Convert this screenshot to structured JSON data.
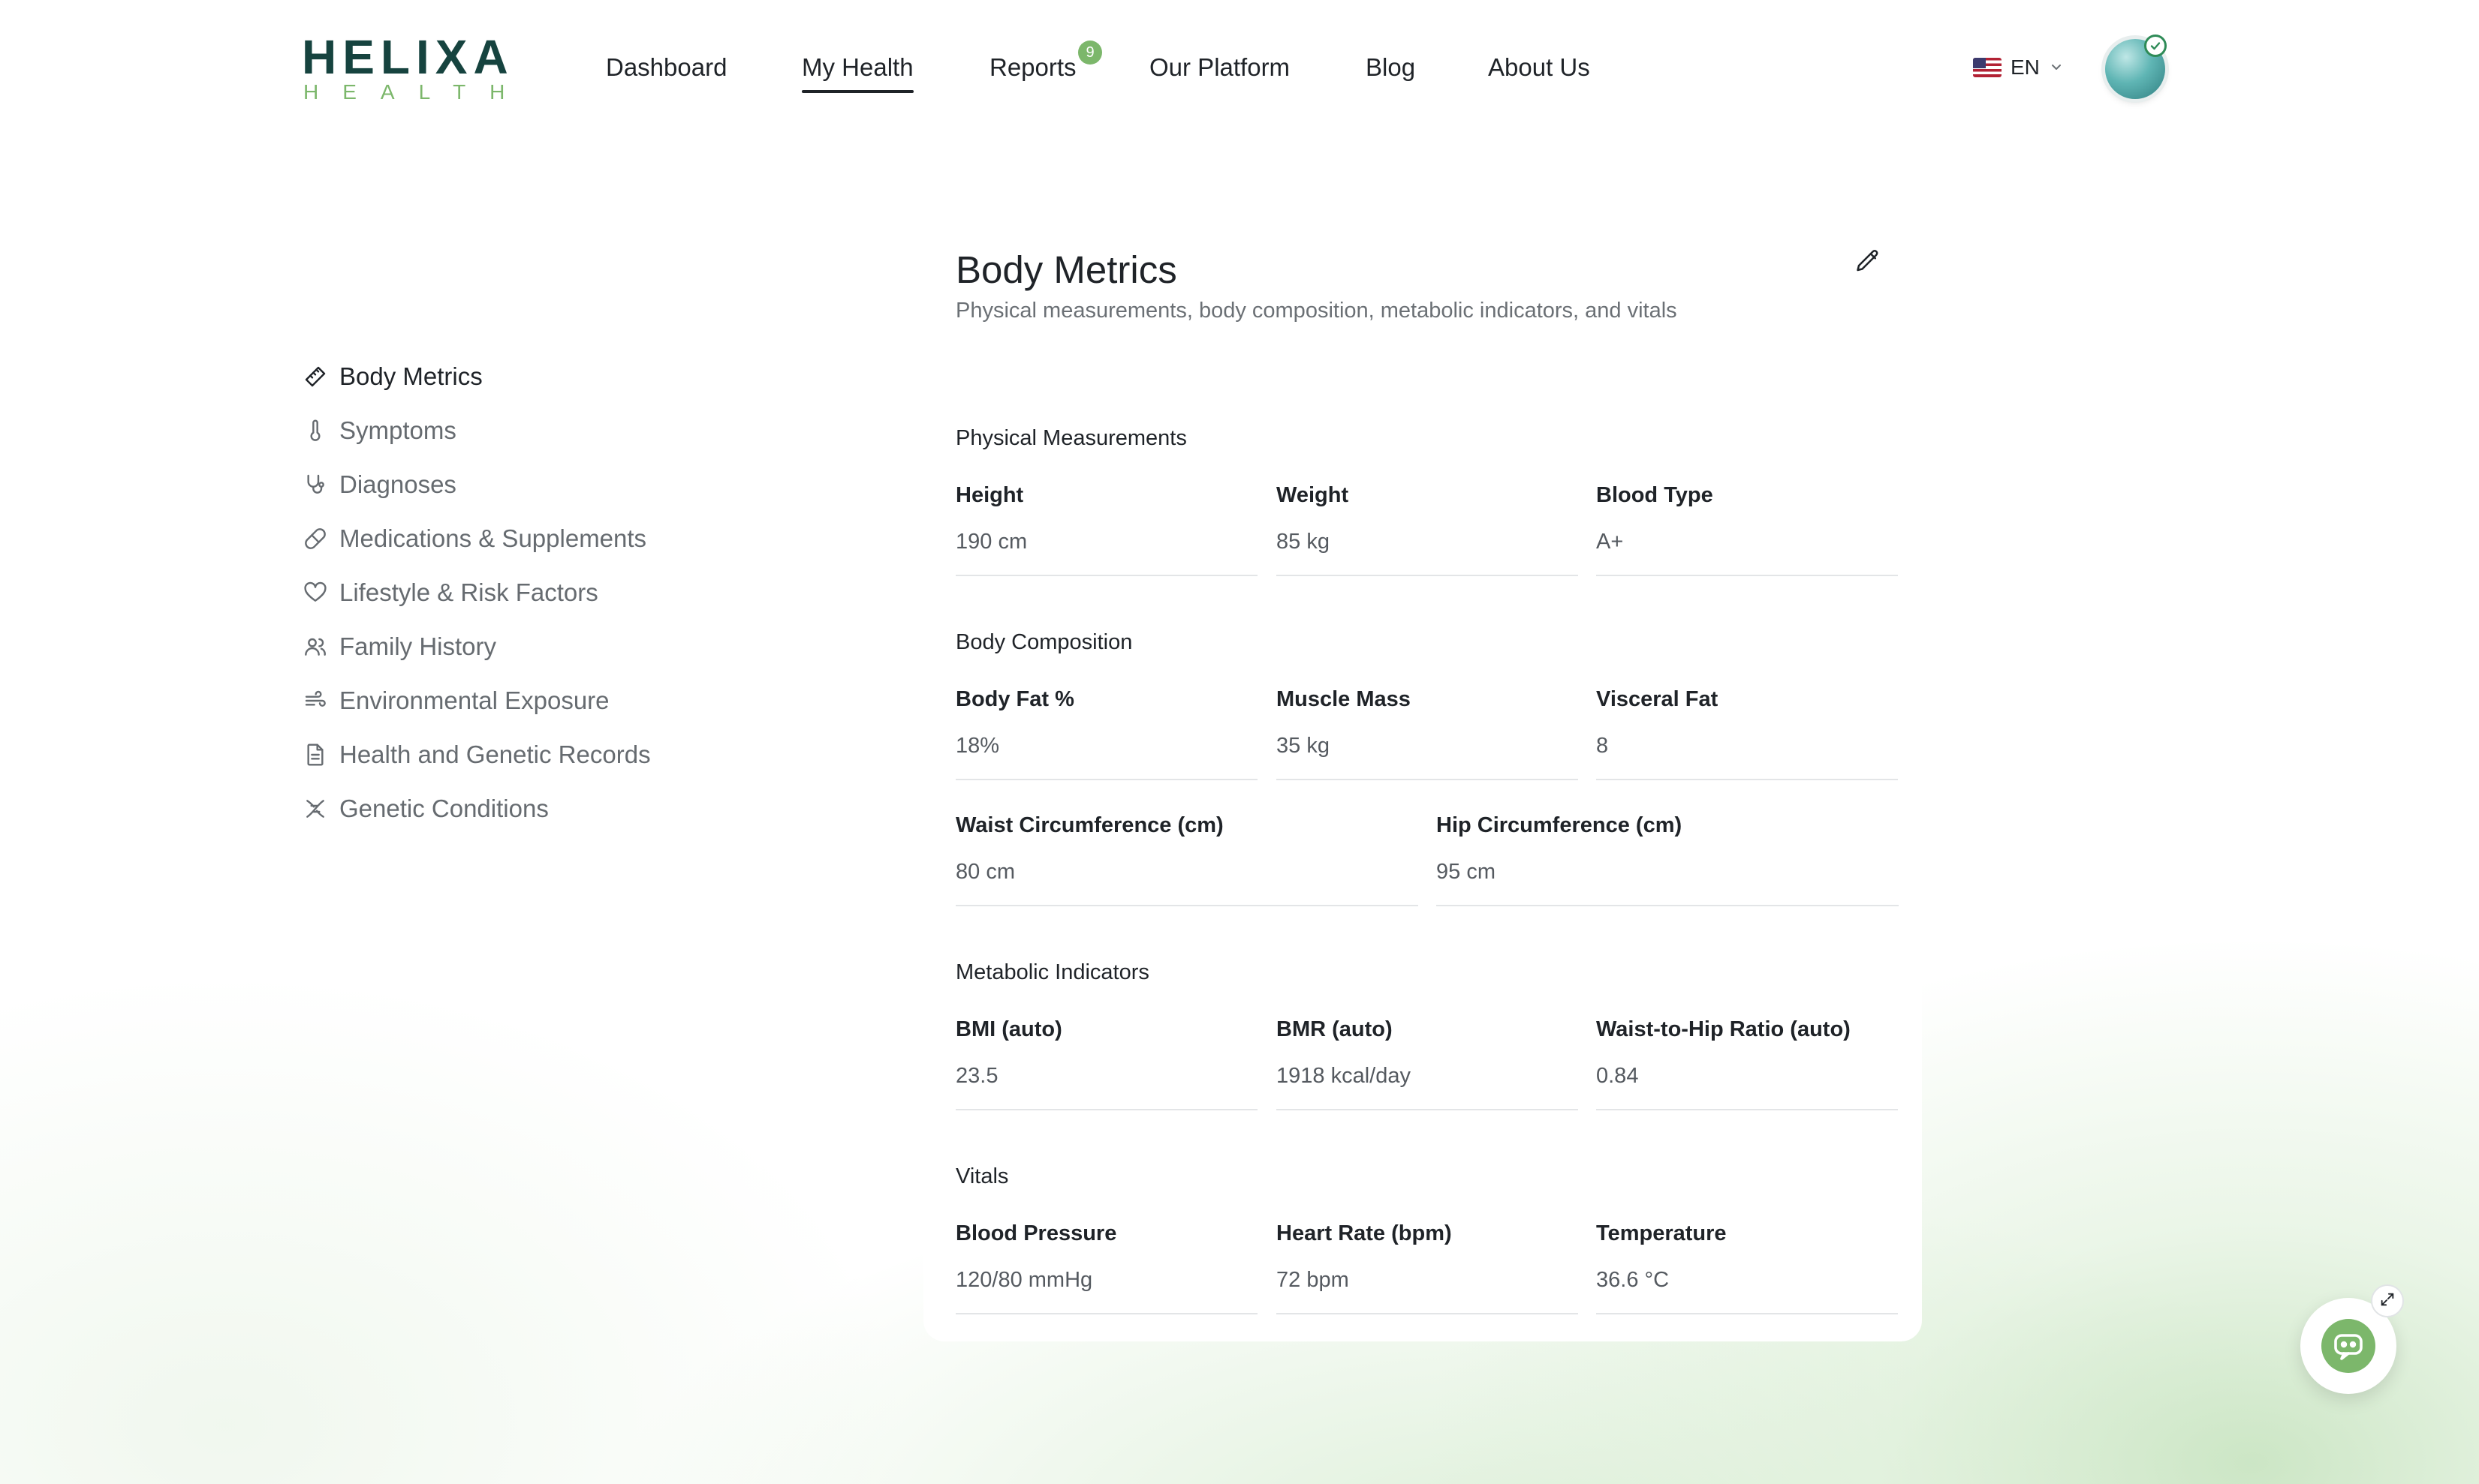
{
  "brand": {
    "top": "HELIXA",
    "bottom": "HEALTH",
    "dark_color": "#16433f",
    "accent_color": "#7cb76b"
  },
  "nav": {
    "items": [
      {
        "label": "Dashboard"
      },
      {
        "label": "My Health",
        "active": true
      },
      {
        "label": "Reports",
        "badge": "9"
      },
      {
        "label": "Our Platform"
      },
      {
        "label": "Blog"
      },
      {
        "label": "About Us"
      }
    ]
  },
  "language": {
    "code": "EN",
    "flag_icon": "us-flag-icon"
  },
  "sidebar": {
    "items": [
      {
        "label": "Body Metrics",
        "icon": "ruler-icon",
        "active": true
      },
      {
        "label": "Symptoms",
        "icon": "thermometer-icon"
      },
      {
        "label": "Diagnoses",
        "icon": "stethoscope-icon"
      },
      {
        "label": "Medications & Supplements",
        "icon": "pill-icon"
      },
      {
        "label": "Lifestyle & Risk Factors",
        "icon": "heart-icon"
      },
      {
        "label": "Family History",
        "icon": "users-icon"
      },
      {
        "label": "Environmental Exposure",
        "icon": "wind-icon"
      },
      {
        "label": "Health and Genetic Records",
        "icon": "document-icon"
      },
      {
        "label": "Genetic Conditions",
        "icon": "dna-icon"
      }
    ]
  },
  "page": {
    "title": "Body Metrics",
    "subtitle": "Physical measurements, body composition, metabolic indicators, and vitals"
  },
  "sections": {
    "physical": {
      "title": "Physical Measurements",
      "fields": [
        {
          "label": "Height",
          "value": "190 cm"
        },
        {
          "label": "Weight",
          "value": "85 kg"
        },
        {
          "label": "Blood Type",
          "value": "A+"
        }
      ]
    },
    "composition": {
      "title": "Body Composition",
      "fields": [
        {
          "label": "Body Fat %",
          "value": "18%"
        },
        {
          "label": "Muscle Mass",
          "value": "35 kg"
        },
        {
          "label": "Visceral Fat",
          "value": "8"
        },
        {
          "label": "Waist Circumference (cm)",
          "value": "80 cm"
        },
        {
          "label": "Hip Circumference (cm)",
          "value": "95 cm"
        }
      ]
    },
    "metabolic": {
      "title": "Metabolic Indicators",
      "fields": [
        {
          "label": "BMI (auto)",
          "value": "23.5"
        },
        {
          "label": "BMR (auto)",
          "value": "1918 kcal/day"
        },
        {
          "label": "Waist-to-Hip Ratio (auto)",
          "value": "0.84"
        }
      ]
    },
    "vitals": {
      "title": "Vitals",
      "fields": [
        {
          "label": "Blood Pressure",
          "value": "120/80 mmHg"
        },
        {
          "label": "Heart Rate (bpm)",
          "value": "72 bpm"
        },
        {
          "label": "Temperature",
          "value": "36.6 °C"
        }
      ]
    }
  }
}
